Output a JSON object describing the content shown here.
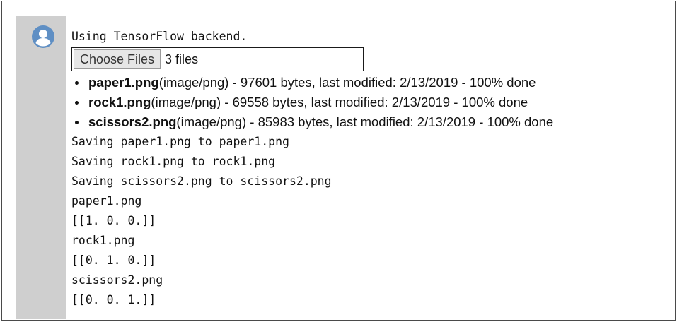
{
  "output": {
    "backend_line": "Using TensorFlow backend.",
    "upload": {
      "button_label": "Choose Files",
      "file_count": "3 files"
    },
    "files": [
      {
        "name": "paper1.png",
        "details": "(image/png) - 97601 bytes, last modified: 2/13/2019 - 100% done"
      },
      {
        "name": "rock1.png",
        "details": "(image/png) - 69558 bytes, last modified: 2/13/2019 - 100% done"
      },
      {
        "name": "scissors2.png",
        "details": "(image/png) - 85983 bytes, last modified: 2/13/2019 - 100% done"
      }
    ],
    "log_lines": [
      "Saving paper1.png to paper1.png",
      "Saving rock1.png to rock1.png",
      "Saving scissors2.png to scissors2.png",
      "paper1.png",
      "[[1. 0. 0.]]",
      "rock1.png",
      "[[0. 1. 0.]]",
      "scissors2.png",
      "[[0. 0. 1.]]"
    ]
  },
  "colors": {
    "gutter": "#cfcfcf",
    "avatar": "#5f8fc4",
    "text": "#111111"
  },
  "icons": {
    "avatar": "user-avatar-icon"
  }
}
